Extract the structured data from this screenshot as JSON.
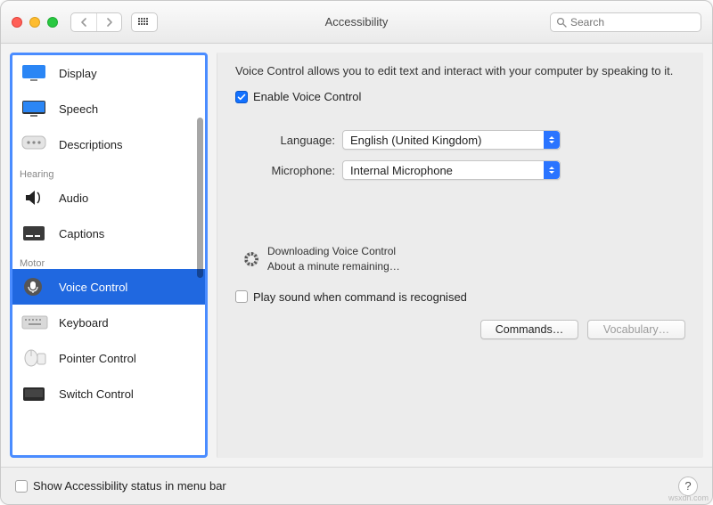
{
  "window": {
    "title": "Accessibility"
  },
  "toolbar": {
    "search_placeholder": "Search"
  },
  "sidebar": {
    "sections": {
      "hearing_label": "Hearing",
      "motor_label": "Motor"
    },
    "items": {
      "display": "Display",
      "speech": "Speech",
      "descriptions": "Descriptions",
      "audio": "Audio",
      "captions": "Captions",
      "voice_control": "Voice Control",
      "keyboard": "Keyboard",
      "pointer_control": "Pointer Control",
      "switch_control": "Switch Control"
    }
  },
  "main": {
    "description": "Voice Control allows you to edit text and interact with your computer by speaking to it.",
    "enable_label": "Enable Voice Control",
    "language_label": "Language:",
    "language_value": "English (United Kingdom)",
    "microphone_label": "Microphone:",
    "microphone_value": "Internal Microphone",
    "download_line1": "Downloading Voice Control",
    "download_line2": "About a minute remaining…",
    "play_sound_label": "Play sound when command is recognised",
    "commands_btn": "Commands…",
    "vocabulary_btn": "Vocabulary…"
  },
  "footer": {
    "status_label": "Show Accessibility status in menu bar"
  },
  "watermark": "wsxdn.com"
}
